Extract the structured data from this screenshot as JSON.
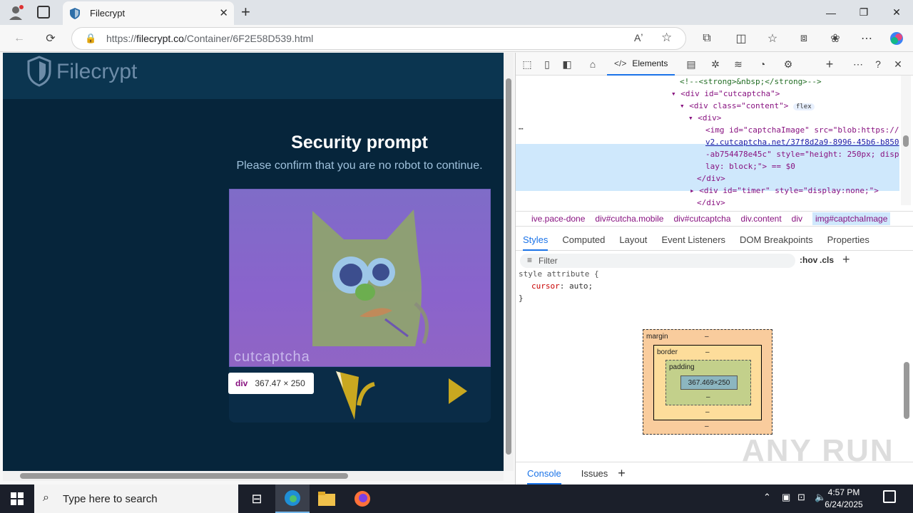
{
  "browser": {
    "tab_title": "Filecrypt",
    "new_tab_symbol": "+",
    "address_prefix": "https://",
    "address_host": "filecrypt.co",
    "address_path": "/Container/6F2E58D539.html"
  },
  "page": {
    "logo_text": "Filecrypt",
    "prompt_title": "Security prompt",
    "prompt_subtitle": "Please confirm that you are no robot to continue.",
    "captcha_brand": "cutcaptcha",
    "tooltip_tag": "div",
    "tooltip_size": "367.47 × 250"
  },
  "devtools": {
    "elements_label": "Elements",
    "dom_lines": [
      "<!--<strong>&nbsp;</strong>-->",
      "<div id=\"cutcaptcha\">",
      "<div class=\"content\">",
      "<div>",
      "<img id=\"captchaImage\" src=\"blob:https://",
      "v2.cutcaptcha.net/37f8d2a9-8996-45b6-b850",
      "-ab754478e45c\" style=\"height: 250px; disp",
      "lay: block;\"> == $0",
      "</div>",
      "<div id=\"timer\" style=\"display:none;\">",
      "</div>"
    ],
    "flex_badge": "flex",
    "breadcrumbs": [
      "ive.pace-done",
      "div#cutcha.mobile",
      "div#cutcaptcha",
      "div.content",
      "div",
      "img#captchaImage"
    ],
    "sub_tabs": [
      "Styles",
      "Computed",
      "Layout",
      "Event Listeners",
      "DOM Breakpoints",
      "Properties"
    ],
    "filter_placeholder": "Filter",
    "filter_tools": [
      ":hov",
      ".cls"
    ],
    "style_rule_selector": "style attribute {",
    "style_prop": "cursor",
    "style_value": "auto;",
    "style_close": "}",
    "box_model": {
      "margin_label": "margin",
      "border_label": "border",
      "padding_label": "padding",
      "content_size": "367.469×250",
      "dash": "–"
    },
    "bottom_tabs": [
      "Console",
      "Issues"
    ]
  },
  "taskbar": {
    "search_placeholder": "Type here to search",
    "time": "4:57 PM",
    "date": "6/24/2025"
  },
  "watermark": "ANY RUN"
}
